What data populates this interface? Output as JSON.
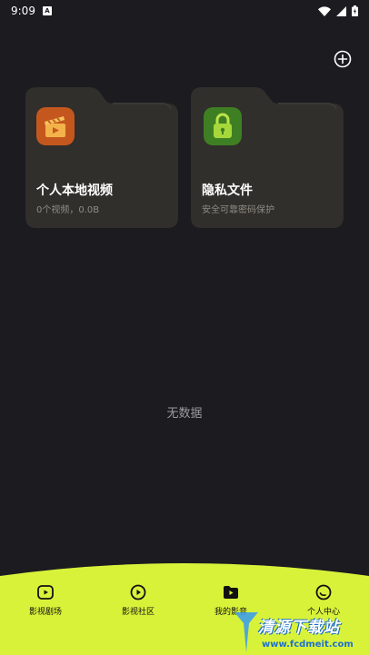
{
  "status_bar": {
    "time": "9:09",
    "notification": "A"
  },
  "folders": [
    {
      "title": "个人本地视频",
      "subtitle": "0个视频，0.0B",
      "icon": "clapperboard-icon"
    },
    {
      "title": "隐私文件",
      "subtitle": "安全可靠密码保护",
      "icon": "padlock-icon"
    }
  ],
  "empty_state": {
    "text": "无数据"
  },
  "bottom_nav": {
    "items": [
      {
        "label": "影视剧场",
        "icon": "play-box-icon"
      },
      {
        "label": "影视社区",
        "icon": "play-circle-icon"
      },
      {
        "label": "我的影音",
        "icon": "media-folder-icon"
      },
      {
        "label": "个人中心",
        "icon": "profile-circle-icon"
      }
    ]
  },
  "watermark": {
    "title": "清源下载站",
    "url": "www.fcdmeit.com"
  },
  "colors": {
    "background": "#1c1b20",
    "folder": "#302f2b",
    "nav_accent": "#d8f23a"
  }
}
